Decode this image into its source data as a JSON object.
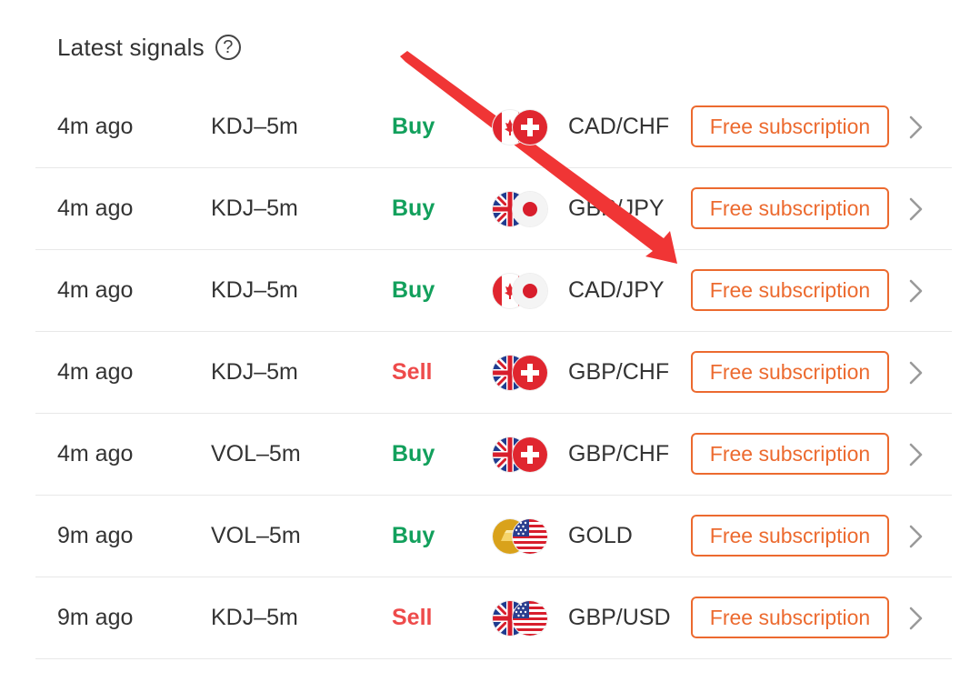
{
  "header": {
    "title": "Latest signals",
    "help_glyph": "?"
  },
  "subscribe_label": "Free subscription",
  "colors": {
    "buy": "#12a05c",
    "sell": "#ee4b4b",
    "accent": "#ec6a2f",
    "annotation_arrow": "#f03535"
  },
  "signals": [
    {
      "time": "4m ago",
      "indicator": "KDJ–5m",
      "action": "Buy",
      "action_type": "buy",
      "pair": "CAD/CHF",
      "base_flag": "canada-flag-icon",
      "quote_flag": "switzerland-flag-icon"
    },
    {
      "time": "4m ago",
      "indicator": "KDJ–5m",
      "action": "Buy",
      "action_type": "buy",
      "pair": "GBP/JPY",
      "base_flag": "uk-flag-icon",
      "quote_flag": "japan-flag-icon"
    },
    {
      "time": "4m ago",
      "indicator": "KDJ–5m",
      "action": "Buy",
      "action_type": "buy",
      "pair": "CAD/JPY",
      "base_flag": "canada-flag-icon",
      "quote_flag": "japan-flag-icon"
    },
    {
      "time": "4m ago",
      "indicator": "KDJ–5m",
      "action": "Sell",
      "action_type": "sell",
      "pair": "GBP/CHF",
      "base_flag": "uk-flag-icon",
      "quote_flag": "switzerland-flag-icon"
    },
    {
      "time": "4m ago",
      "indicator": "VOL–5m",
      "action": "Buy",
      "action_type": "buy",
      "pair": "GBP/CHF",
      "base_flag": "uk-flag-icon",
      "quote_flag": "switzerland-flag-icon"
    },
    {
      "time": "9m ago",
      "indicator": "VOL–5m",
      "action": "Buy",
      "action_type": "buy",
      "pair": "GOLD",
      "base_flag": "gold-icon",
      "quote_flag": "usa-flag-icon"
    },
    {
      "time": "9m ago",
      "indicator": "KDJ–5m",
      "action": "Sell",
      "action_type": "sell",
      "pair": "GBP/USD",
      "base_flag": "uk-flag-icon",
      "quote_flag": "usa-flag-icon"
    }
  ]
}
